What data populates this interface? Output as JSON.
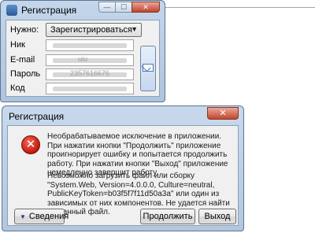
{
  "form_window": {
    "title": "Регистрация",
    "caption_buttons": {
      "minimize": "—",
      "maximize": "☐",
      "close": "✕"
    },
    "mode_label": "Нужно:",
    "mode_value": "Зарегистрироваться",
    "fields": [
      {
        "label": "Ник",
        "value": ""
      },
      {
        "label": "E-mail",
        "value": "uiu"
      },
      {
        "label": "Пароль",
        "value": "2357616676"
      },
      {
        "label": "Код",
        "value": ""
      }
    ],
    "send_icon": "envelope-icon"
  },
  "error_dialog": {
    "title": "Регистрация",
    "close_label": "✕",
    "icon": "error-icon",
    "message_1": "Необрабатываемое исключение в приложении. При нажатии кнопки \"Продолжить\" приложение проигнорирует ошибку и попытается продолжить работу. При нажатии кнопки \"Выход\" приложение немедленно завершит работу.",
    "message_2": "Невозможно загрузить файл или сборку \"System.Web, Version=4.0.0.0, Culture=neutral, PublicKeyToken=b03f5f7f11d50a3a\" или один из зависимых от них компонентов. Не удается найти указанный файл.",
    "details_label": "Сведения",
    "continue_label": "Продолжить",
    "exit_label": "Выход"
  }
}
